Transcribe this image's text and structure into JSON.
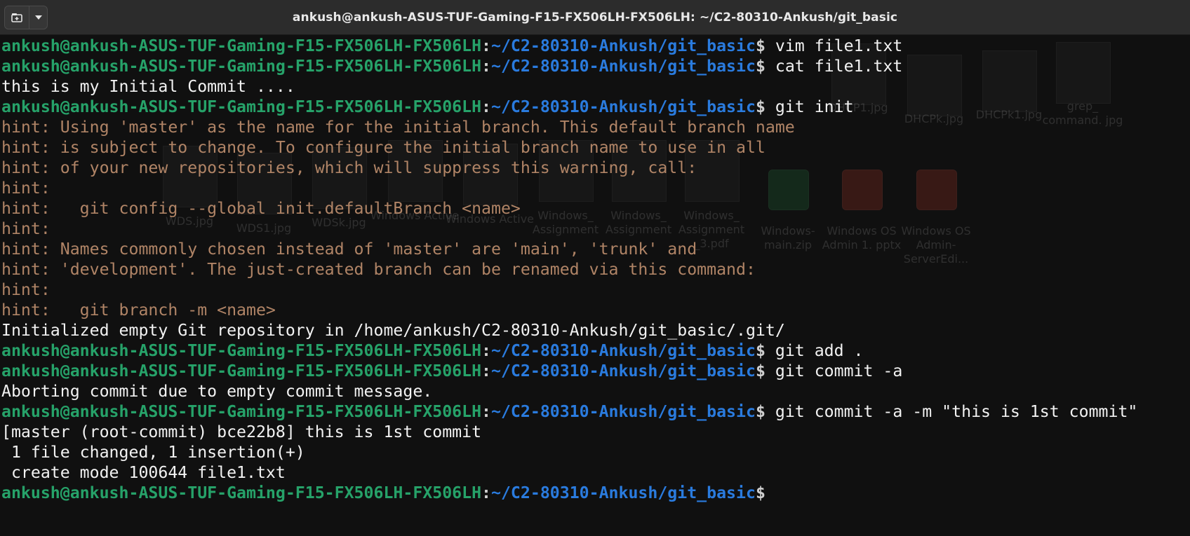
{
  "window": {
    "title": "ankush@ankush-ASUS-TUF-Gaming-F15-FX506LH-FX506LH: ~/C2-80310-Ankush/git_basic",
    "new_tab_icon": "new-tab-icon",
    "menu_icon": "chevron-down-icon"
  },
  "colors": {
    "user": "#26a269",
    "path": "#2a7bde",
    "hint": "#b08466",
    "background": "#101010"
  },
  "prompt": {
    "user": "ankush@ankush-ASUS-TUF-Gaming-F15-FX506LH-FX506LH",
    "sep": ":",
    "path": "~/C2-80310-Ankush/git_basic",
    "symbol": "$"
  },
  "lines": [
    {
      "type": "prompt",
      "cmd": " vim file1.txt"
    },
    {
      "type": "prompt",
      "cmd": " cat file1.txt"
    },
    {
      "type": "out",
      "text": "this is my Initial Commit ...."
    },
    {
      "type": "prompt",
      "cmd": " git init"
    },
    {
      "type": "hint",
      "text": "hint: Using 'master' as the name for the initial branch. This default branch name"
    },
    {
      "type": "hint",
      "text": "hint: is subject to change. To configure the initial branch name to use in all"
    },
    {
      "type": "hint",
      "text": "hint: of your new repositories, which will suppress this warning, call:"
    },
    {
      "type": "hint",
      "text": "hint:"
    },
    {
      "type": "hint",
      "text": "hint: \tgit config --global init.defaultBranch <name>"
    },
    {
      "type": "hint",
      "text": "hint:"
    },
    {
      "type": "hint",
      "text": "hint: Names commonly chosen instead of 'master' are 'main', 'trunk' and"
    },
    {
      "type": "hint",
      "text": "hint: 'development'. The just-created branch can be renamed via this command:"
    },
    {
      "type": "hint",
      "text": "hint:"
    },
    {
      "type": "hint",
      "text": "hint: \tgit branch -m <name>"
    },
    {
      "type": "out",
      "text": "Initialized empty Git repository in /home/ankush/C2-80310-Ankush/git_basic/.git/"
    },
    {
      "type": "prompt",
      "cmd": " git add ."
    },
    {
      "type": "prompt",
      "cmd": " git commit -a"
    },
    {
      "type": "out",
      "text": "Aborting commit due to empty commit message."
    },
    {
      "type": "prompt",
      "cmd": " git commit -a -m \"this is 1st commit\""
    },
    {
      "type": "out",
      "text": "[master (root-commit) bce22b8] this is 1st commit"
    },
    {
      "type": "out",
      "text": " 1 file changed, 1 insertion(+)"
    },
    {
      "type": "out",
      "text": " create mode 100644 file1.txt"
    },
    {
      "type": "prompt",
      "cmd": ""
    }
  ],
  "desktop_ghost": [
    {
      "label": "DHCP1.jpg",
      "kind": "image"
    },
    {
      "label": "DHCPk.jpg",
      "kind": "image"
    },
    {
      "label": "DHCPk1.jpg",
      "kind": "image"
    },
    {
      "label": "grep_ command. jpg",
      "kind": "image"
    },
    {
      "label": "WDS.jpg",
      "kind": "image"
    },
    {
      "label": "WDS1.jpg",
      "kind": "image"
    },
    {
      "label": "WDSk.jpg",
      "kind": "image"
    },
    {
      "label": "Windows Active",
      "kind": "image"
    },
    {
      "label": "Windows Active",
      "kind": "image"
    },
    {
      "label": "Windows_ Assignment",
      "kind": "doc"
    },
    {
      "label": "Windows_ Assignment",
      "kind": "doc"
    },
    {
      "label": "Windows_ Assignment _3.pdf",
      "kind": "doc"
    },
    {
      "label": "Windows- main.zip",
      "kind": "zip"
    },
    {
      "label": "Windows OS Admin 1. pptx",
      "kind": "ppt"
    },
    {
      "label": "Windows OS Admin- ServerEdi...",
      "kind": "ppt"
    }
  ]
}
